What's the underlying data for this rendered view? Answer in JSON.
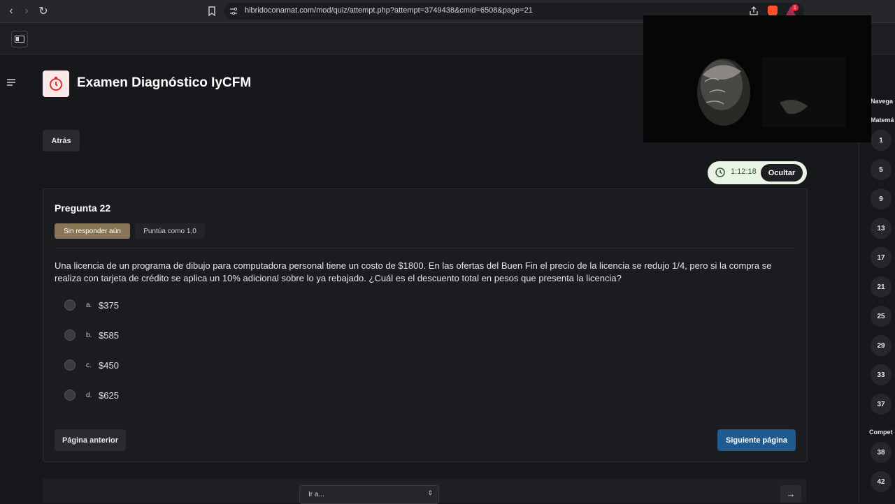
{
  "browser": {
    "url": "hibridoconamat.com/mod/quiz/attempt.php?attempt=3749438&cmid=6508&page=21",
    "notification_count": "1"
  },
  "header": {
    "title": "Examen Diagnóstico IyCFM",
    "back_label": "Atrás"
  },
  "timer": {
    "value": "1:12:18",
    "hide_label": "Ocultar"
  },
  "question": {
    "number_label": "Pregunta 22",
    "status": "Sin responder aún",
    "points": "Puntúa como 1,0",
    "text": "Una licencia de un programa de dibujo para computadora personal tiene un costo de $1800. En las ofertas del Buen Fin el precio de la licencia se redujo 1/4, pero si la compra se realiza con tarjeta de crédito se aplica un 10% adicional sobre lo ya rebajado. ¿Cuál es el descuento total en pesos que presenta la licencia?",
    "options": [
      {
        "letter": "a.",
        "value": "$375"
      },
      {
        "letter": "b.",
        "value": "$585"
      },
      {
        "letter": "c.",
        "value": "$450"
      },
      {
        "letter": "d.",
        "value": "$625"
      }
    ]
  },
  "pagination": {
    "prev_label": "Página anterior",
    "next_label": "Siguiente página",
    "jump_placeholder": "Ir a..."
  },
  "quiz_nav": {
    "heading": "Navega",
    "section1": "Matemá",
    "section2": "Compet",
    "numbers_section1": [
      "1",
      "5",
      "9",
      "13",
      "17",
      "21",
      "25",
      "29",
      "33",
      "37"
    ],
    "numbers_section2": [
      "38",
      "42"
    ]
  },
  "colors": {
    "status_badge": "#877556",
    "primary_button": "#1f5b8f",
    "timer_bg": "#eaf4e4"
  }
}
